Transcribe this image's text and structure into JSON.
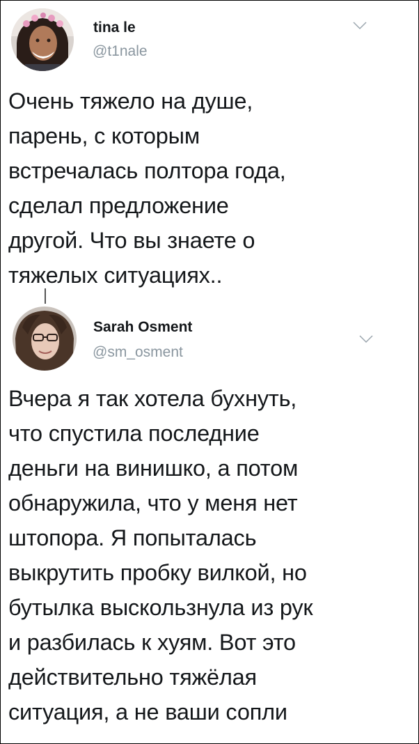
{
  "tweets": [
    {
      "author": "tina le",
      "handle": "@t1nale",
      "text_lines": [
        "Очень тяжело на душе,",
        "парень, с которым",
        "встречалась полтора года,",
        "сделал предложение",
        "другой. Что вы знаете о",
        "тяжелых ситуациях.."
      ],
      "icons": {
        "avatar": "avatar-photo",
        "menu": "chevron-down-icon"
      }
    },
    {
      "author": "Sarah Osment",
      "handle": "@sm_osment",
      "text_lines": [
        "Вчера я так хотела бухнуть,",
        "что спустила последние",
        "деньги на винишко, а потом",
        "обнаружила, что у меня нет",
        "штопора. Я попыталась",
        "выкрутить пробку вилкой, но",
        "бутылка выскользнула из рук",
        "и разбилась к хуям. Вот это",
        "действительно тяжёлая",
        "ситуация, а не ваши сопли"
      ],
      "icons": {
        "avatar": "avatar-photo",
        "menu": "chevron-down-icon"
      }
    }
  ],
  "colors": {
    "text": "#14171a",
    "handle": "#8a969f",
    "background": "#ffffff"
  }
}
